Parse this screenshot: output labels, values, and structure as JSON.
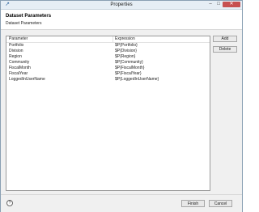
{
  "window": {
    "title": "Properties",
    "icon": "app-icon",
    "controls": {
      "minimize": "–",
      "maximize": "□",
      "close": "✕"
    }
  },
  "banner": {
    "title": "Dataset Parameters",
    "subtitle": "Dataset Parameters"
  },
  "table": {
    "columns": [
      "Parameter",
      "Expression"
    ],
    "rows": [
      {
        "parameter": "Portfolio",
        "expression": "$P{Portfolio}"
      },
      {
        "parameter": "Division",
        "expression": "$P{Division}"
      },
      {
        "parameter": "Region",
        "expression": "$P{Region}"
      },
      {
        "parameter": "Community",
        "expression": "$P{Community}"
      },
      {
        "parameter": "FiscalMonth",
        "expression": "$P{FiscalMonth}"
      },
      {
        "parameter": "FiscalYear",
        "expression": "$P{FiscalYear}"
      },
      {
        "parameter": "LoggedInUserName",
        "expression": "$P{LoggedInUserName}"
      }
    ]
  },
  "side_buttons": {
    "add": "Add",
    "delete": "Delete"
  },
  "footer": {
    "help": "?",
    "finish": "Finish",
    "cancel": "Cancel"
  }
}
